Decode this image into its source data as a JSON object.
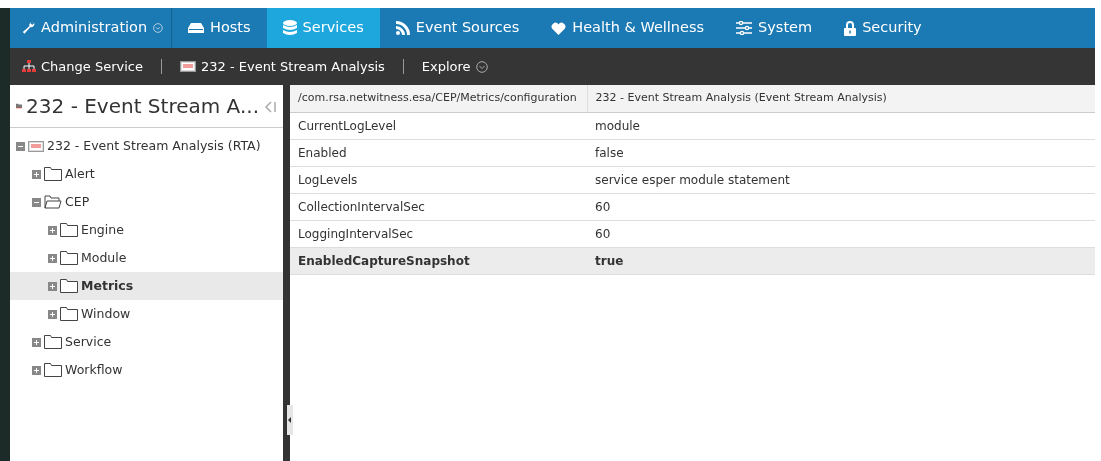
{
  "nav": {
    "menu": {
      "label": "Administration"
    },
    "tabs": [
      {
        "label": "Hosts",
        "selected": false
      },
      {
        "label": "Services",
        "selected": true
      },
      {
        "label": "Event Sources",
        "selected": false
      },
      {
        "label": "Health & Wellness",
        "selected": false
      },
      {
        "label": "System",
        "selected": false
      },
      {
        "label": "Security",
        "selected": false
      }
    ]
  },
  "toolbar": {
    "change_service": "Change Service",
    "service": "232 - Event Stream Analysis",
    "explore": "Explore"
  },
  "sidebar": {
    "title": "232 - Event Stream A...",
    "tree": [
      {
        "label": "232 - Event Stream Analysis (RTA)",
        "kind": "service",
        "expanded": true,
        "selected": false,
        "children": [
          {
            "label": "Alert",
            "kind": "folder",
            "expanded": false,
            "selected": false
          },
          {
            "label": "CEP",
            "kind": "folder",
            "expanded": true,
            "selected": false,
            "children": [
              {
                "label": "Engine",
                "kind": "folder",
                "expanded": false,
                "selected": false
              },
              {
                "label": "Module",
                "kind": "folder",
                "expanded": false,
                "selected": false
              },
              {
                "label": "Metrics",
                "kind": "folder",
                "expanded": false,
                "selected": true
              },
              {
                "label": "Window",
                "kind": "folder",
                "expanded": false,
                "selected": false
              }
            ]
          },
          {
            "label": "Service",
            "kind": "folder",
            "expanded": false,
            "selected": false
          },
          {
            "label": "Workflow",
            "kind": "folder",
            "expanded": false,
            "selected": false
          }
        ]
      }
    ]
  },
  "table": {
    "columns": [
      "/com.rsa.netwitness.esa/CEP/Metrics/configuration",
      "232 - Event Stream Analysis (Event Stream Analysis)"
    ],
    "rows": [
      {
        "name": "CurrentLogLevel",
        "value": "module",
        "selected": false
      },
      {
        "name": "Enabled",
        "value": "false",
        "selected": false
      },
      {
        "name": "LogLevels",
        "value": "service esper module statement",
        "selected": false
      },
      {
        "name": "CollectionIntervalSec",
        "value": "60",
        "selected": false
      },
      {
        "name": "LoggingIntervalSec",
        "value": "60",
        "selected": false
      },
      {
        "name": "EnabledCaptureSnapshot",
        "value": "true",
        "selected": true
      }
    ]
  }
}
